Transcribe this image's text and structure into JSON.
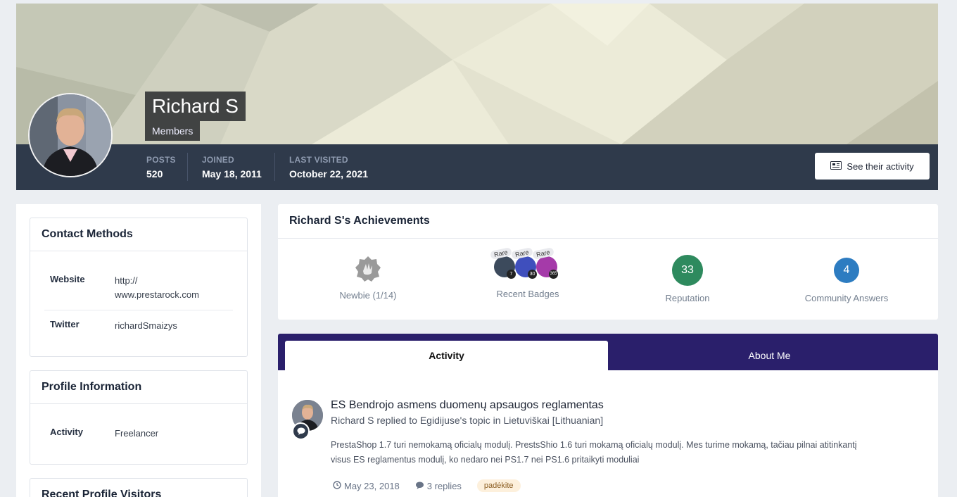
{
  "profile": {
    "name": "Richard S",
    "group": "Members",
    "stats": [
      {
        "label": "Posts",
        "value": "520"
      },
      {
        "label": "Joined",
        "value": "May 18, 2011"
      },
      {
        "label": "Last Visited",
        "value": "October 22, 2021"
      }
    ],
    "activity_button": "See their activity"
  },
  "contact": {
    "title": "Contact Methods",
    "website_label": "Website",
    "website_value_1": "http://",
    "website_value_2": "www.prestarock.com",
    "twitter_label": "Twitter",
    "twitter_value": "richardSmaizys"
  },
  "profile_info": {
    "title": "Profile Information",
    "activity_label": "Activity",
    "activity_value": "Freelancer"
  },
  "visitors": {
    "title": "Recent Profile Visitors"
  },
  "achievements": {
    "title": "Richard S's Achievements",
    "rank_label": "Newbie (1/14)",
    "badges_label": "Recent Badges",
    "badge_tag": "Rare",
    "badge_counts": [
      "7",
      "30",
      "365"
    ],
    "reputation_value": "33",
    "reputation_label": "Reputation",
    "answers_value": "4",
    "answers_label": "Community Answers",
    "reputation_color": "#2e8a5e",
    "answers_color": "#2d7cc1"
  },
  "tabs": [
    "Activity",
    "About Me"
  ],
  "feed": {
    "title": "ES Bendrojo asmens duomenų apsaugos reglamentas",
    "subtitle": "Richard S replied to Egidijuse's topic in Lietuviškai [Lithuanian]",
    "body_1": "PrestaShop 1.7 turi nemokamą oficialų modulį. PrestsShio 1.6 turi mokamą oficialų modulį. Mes turime mokamą, tačiau pilnai atitinkantį",
    "body_2": "visus ES reglamentus modulį, ko nedaro nei PS1.7 nei PS1.6 pritaikyti moduliai",
    "date": "May 23, 2018",
    "replies": "3 replies",
    "tag": "padėkite"
  }
}
